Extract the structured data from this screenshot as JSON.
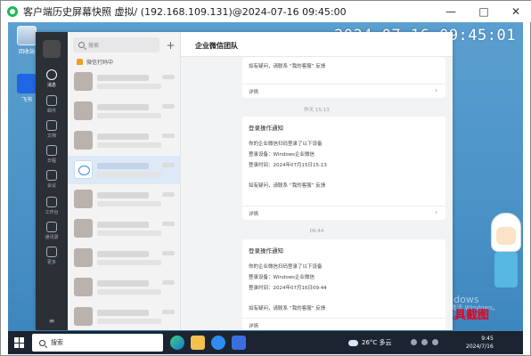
{
  "window": {
    "title": "客户端历史屏幕快照 虚拟/    (192.168.109.131)@2024-07-16 09:45:00",
    "min_label": "—",
    "max_label": "□",
    "close_label": "✕"
  },
  "desktop": {
    "icons": [
      {
        "label": "回收站",
        "icon": "recycle-bin-icon"
      },
      {
        "label": "飞书",
        "icon": "feishu-icon"
      }
    ],
    "clock_overlay": "2024-07-16 09:45:01",
    "watermark_line1": "激活 Windows",
    "watermark_line2": "转到“设置”以激活 Windows。",
    "caption": "聊天工具截图"
  },
  "wecom": {
    "nav": {
      "items": [
        {
          "label": "消息",
          "icon": "message-icon"
        },
        {
          "label": "邮件",
          "icon": "mail-icon"
        },
        {
          "label": "文档",
          "icon": "document-icon"
        },
        {
          "label": "日程",
          "icon": "calendar-icon"
        },
        {
          "label": "会议",
          "icon": "meeting-icon"
        },
        {
          "label": "工作台",
          "icon": "workbench-icon"
        },
        {
          "label": "通讯录",
          "icon": "contacts-icon"
        },
        {
          "label": "更多",
          "icon": "more-icon"
        }
      ],
      "bottom_icon": "menu-icon"
    },
    "list": {
      "search_placeholder": "搜索",
      "add_label": "+",
      "notice": "微信打码中",
      "conversations": [
        {
          "selected": false
        },
        {
          "selected": false
        },
        {
          "selected": false
        },
        {
          "selected": true
        },
        {
          "selected": false
        },
        {
          "selected": false
        },
        {
          "selected": false
        },
        {
          "selected": false
        },
        {
          "selected": false
        }
      ]
    },
    "chat": {
      "title": "企业微信团队",
      "cards": [
        {
          "partial_line": "如有疑问，请联系 “我的客服” 反馈",
          "footer": "详情"
        },
        {
          "time": "昨天 15:13",
          "title": "登录操作通知",
          "lines": [
            "你的企业微信扫码登录了以下设备",
            "登录设备：Windows企业微信",
            "登录时间：2024年07月15日15:13"
          ],
          "contact": "如有疑问，请联系 “我的客服” 反馈",
          "footer": "详情"
        },
        {
          "time": "09:44",
          "title": "登录操作通知",
          "lines": [
            "你的企业微信扫码登录了以下设备",
            "登录设备：Windows企业微信",
            "登录时间：2024年07月16日09:44"
          ],
          "contact": "如有疑问，请联系 “我的客服” 反馈",
          "footer": "详情"
        }
      ]
    }
  },
  "taskbar": {
    "search_label": "搜索",
    "weather": "26°C 多云",
    "time": "9:45",
    "date": "2024/7/16",
    "apps": [
      "edge-icon",
      "file-explorer-icon",
      "wecom-icon",
      "feishu-icon"
    ]
  }
}
